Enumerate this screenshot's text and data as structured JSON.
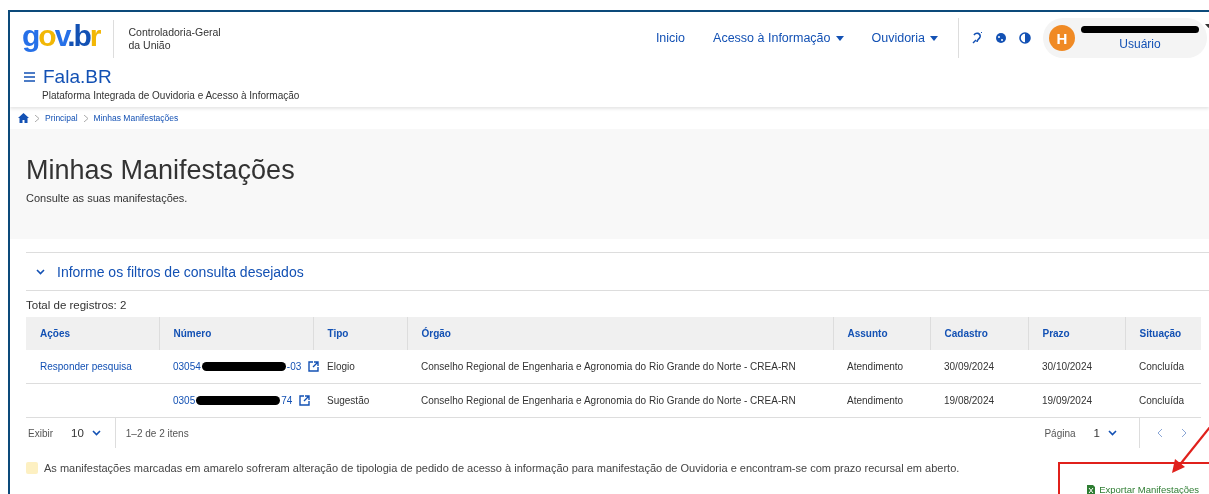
{
  "header": {
    "logo": "gov.br",
    "org_line1": "Controladoria-Geral",
    "org_line2": "da União",
    "app_title": "Fala.BR",
    "app_subtitle": "Plataforma Integrada de Ouvidoria e Acesso à Informação",
    "nav": [
      {
        "label": "Inicio",
        "dropdown": false
      },
      {
        "label": "Acesso à Informação",
        "dropdown": true
      },
      {
        "label": "Ouvidoria",
        "dropdown": true
      }
    ],
    "user": {
      "initial": "H",
      "role": "Usuário"
    }
  },
  "breadcrumb": [
    "Principal",
    "Minhas Manifestações"
  ],
  "page": {
    "title": "Minhas Manifestações",
    "subtitle": "Consulte as suas manifestações."
  },
  "filters": {
    "label": "Informe os filtros de consulta desejados",
    "expanded": false
  },
  "total": "Total de registros: 2",
  "table": {
    "columns": [
      "Ações",
      "Número",
      "Tipo",
      "Órgão",
      "Assunto",
      "Cadastro",
      "Prazo",
      "Situação"
    ],
    "rows": [
      {
        "action": "Responder pesquisa",
        "number_start": "03054",
        "number_end": "-03",
        "type": "Elogio",
        "agency": "Conselho Regional de Engenharia e Agronomia do Rio Grande do Norte - CREA-RN",
        "subject": "Atendimento",
        "registered": "30/09/2024",
        "deadline": "30/10/2024",
        "status": "Concluída"
      },
      {
        "number_start": "0305",
        "number_end": "74",
        "type": "Sugestão",
        "agency": "Conselho Regional de Engenharia e Agronomia do Rio Grande do Norte - CREA-RN",
        "subject": "Atendimento",
        "registered": "19/08/2024",
        "deadline": "19/09/2024",
        "status": "Concluída"
      }
    ]
  },
  "pagination": {
    "show_label": "Exibir",
    "page_size": "10",
    "range": "1–2 de 2 itens",
    "page_label": "Página",
    "page": "1"
  },
  "note": "As manifestações marcadas em amarelo sofreram alteração de tipologia de pedido de acesso à informação para manifestação de Ouvidoria e encontram-se com prazo recursal em aberto.",
  "export": {
    "label": "Exportar Manifestações",
    "highlighted": true
  }
}
